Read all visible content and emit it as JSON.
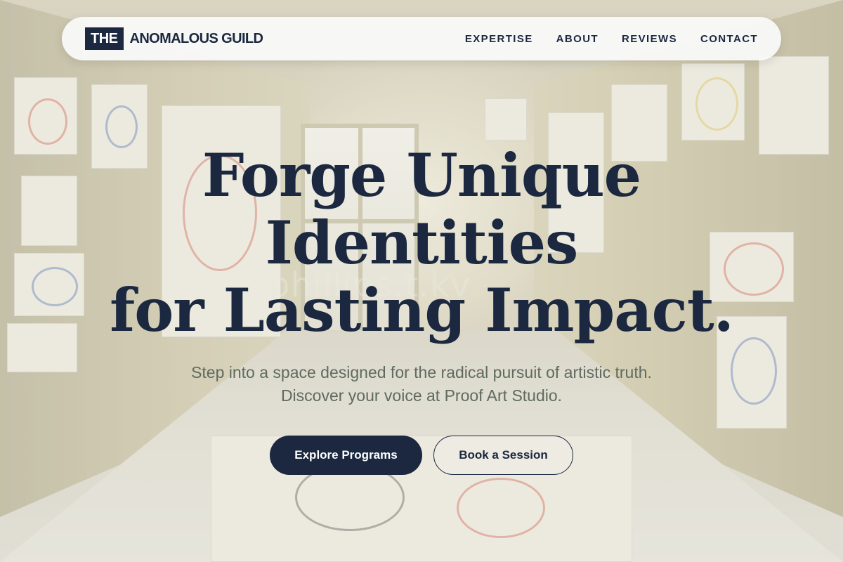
{
  "nav": {
    "logo_badge": "THE",
    "logo_text": "ANOMALOUS GUILD",
    "links": [
      {
        "label": "EXPERTISE"
      },
      {
        "label": "ABOUT"
      },
      {
        "label": "REVIEWS"
      },
      {
        "label": "CONTACT"
      }
    ]
  },
  "hero": {
    "title_lines": [
      "Forge Unique",
      "Identities",
      "for Lasting Impact."
    ],
    "subtitle": "Step into a space designed for the radical pursuit of artistic truth. Discover your voice at Proof Art Studio.",
    "primary_cta": "Explore Programs",
    "secondary_cta": "Book a Session",
    "watermark": "phillips.t.kv"
  },
  "colors": {
    "primary": "#1b2840",
    "nav_background": "#f8f8f7",
    "subtitle_text": "#5f6a60"
  }
}
